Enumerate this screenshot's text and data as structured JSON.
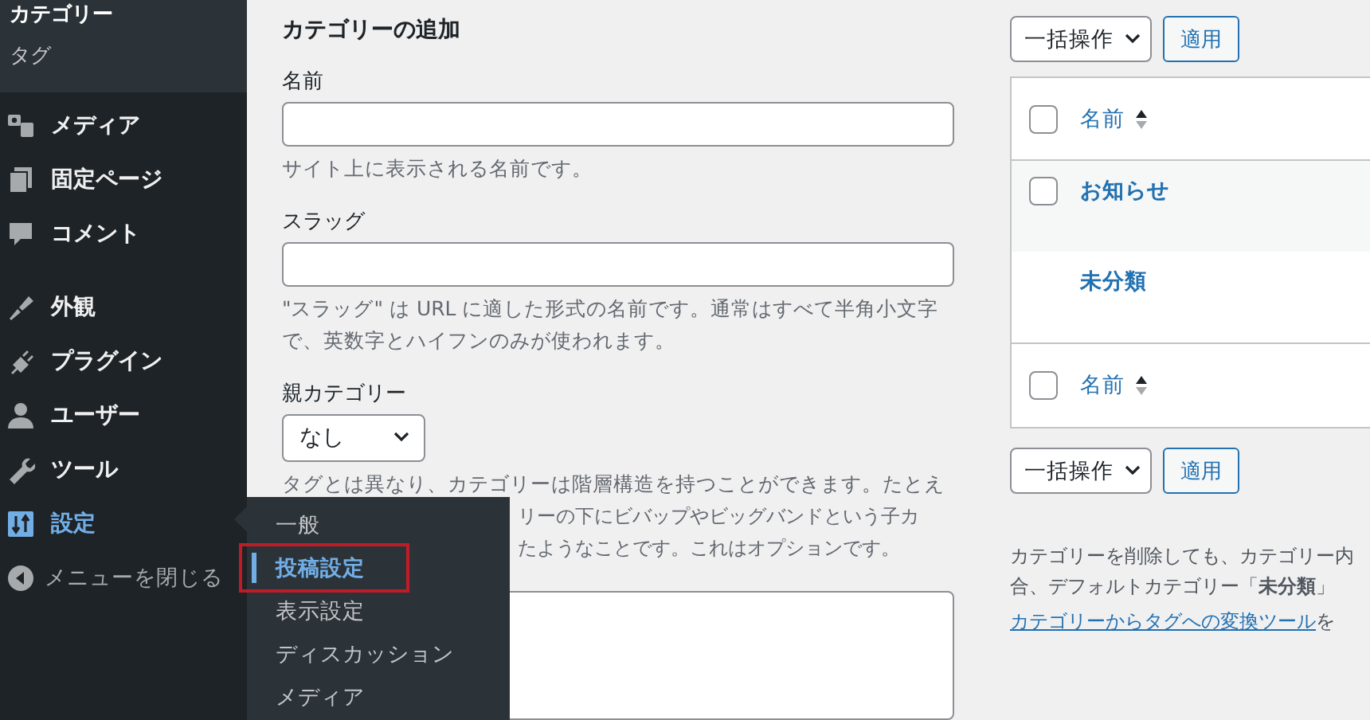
{
  "sidebar": {
    "submenu": [
      {
        "label": "カテゴリー",
        "selected": true
      },
      {
        "label": "タグ",
        "selected": false
      }
    ],
    "items": [
      {
        "kind": "menu",
        "label": "メディア",
        "selected": false
      },
      {
        "kind": "menu",
        "label": "固定ページ",
        "selected": false
      },
      {
        "kind": "menu",
        "label": "コメント",
        "selected": false
      },
      {
        "kind": "menu",
        "label": "外観",
        "selected": false
      },
      {
        "kind": "menu",
        "label": "プラグイン",
        "selected": false
      },
      {
        "kind": "menu",
        "label": "ユーザー",
        "selected": false
      },
      {
        "kind": "menu",
        "label": "ツール",
        "selected": false
      },
      {
        "kind": "menu",
        "label": "設定",
        "selected": true
      },
      {
        "kind": "collapse",
        "label": "メニューを閉じる",
        "selected": false
      }
    ]
  },
  "flyout": {
    "items": [
      {
        "label": "一般",
        "selected": false,
        "highlighted": false
      },
      {
        "label": "投稿設定",
        "selected": true,
        "highlighted": true
      },
      {
        "label": "表示設定",
        "selected": false,
        "highlighted": false
      },
      {
        "label": "ディスカッション",
        "selected": false,
        "highlighted": false
      },
      {
        "label": "メディア",
        "selected": false,
        "highlighted": false
      }
    ]
  },
  "form": {
    "title": "カテゴリーの追加",
    "name": {
      "label": "名前",
      "hint": "サイト上に表示される名前です。"
    },
    "slug": {
      "label": "スラッグ",
      "hint": "\"スラッグ\" は URL に適した形式の名前です。通常はすべて半角小文字で、英数字とハイフンのみが使われます。"
    },
    "parent": {
      "label": "親カテゴリー",
      "value": "なし",
      "hint_lines": [
        "タグとは異なり、カテゴリーは階層構造を持つことができます。たとえ",
        "リーの下にビバップやビッグバンドという子カ",
        "たようなことです。これはオプションです。"
      ]
    }
  },
  "list": {
    "bulk_top": {
      "value": "一括操作",
      "button": "適用"
    },
    "header": {
      "label": "名前",
      "checked": false
    },
    "rows": [
      {
        "kind": "checkbox",
        "name": "お知らせ",
        "checked": false
      },
      {
        "kind": "plain",
        "name": "未分類"
      }
    ],
    "footer": {
      "label": "名前",
      "checked": false
    },
    "bulk_bottom": {
      "value": "一括操作",
      "button": "適用"
    },
    "note_lines": [
      "カテゴリーを削除しても、カテゴリー内",
      "合、デフォルトカテゴリー「**未分類**」"
    ],
    "convert_link": "カテゴリーからタグへの変換ツール",
    "convert_after": "を"
  }
}
